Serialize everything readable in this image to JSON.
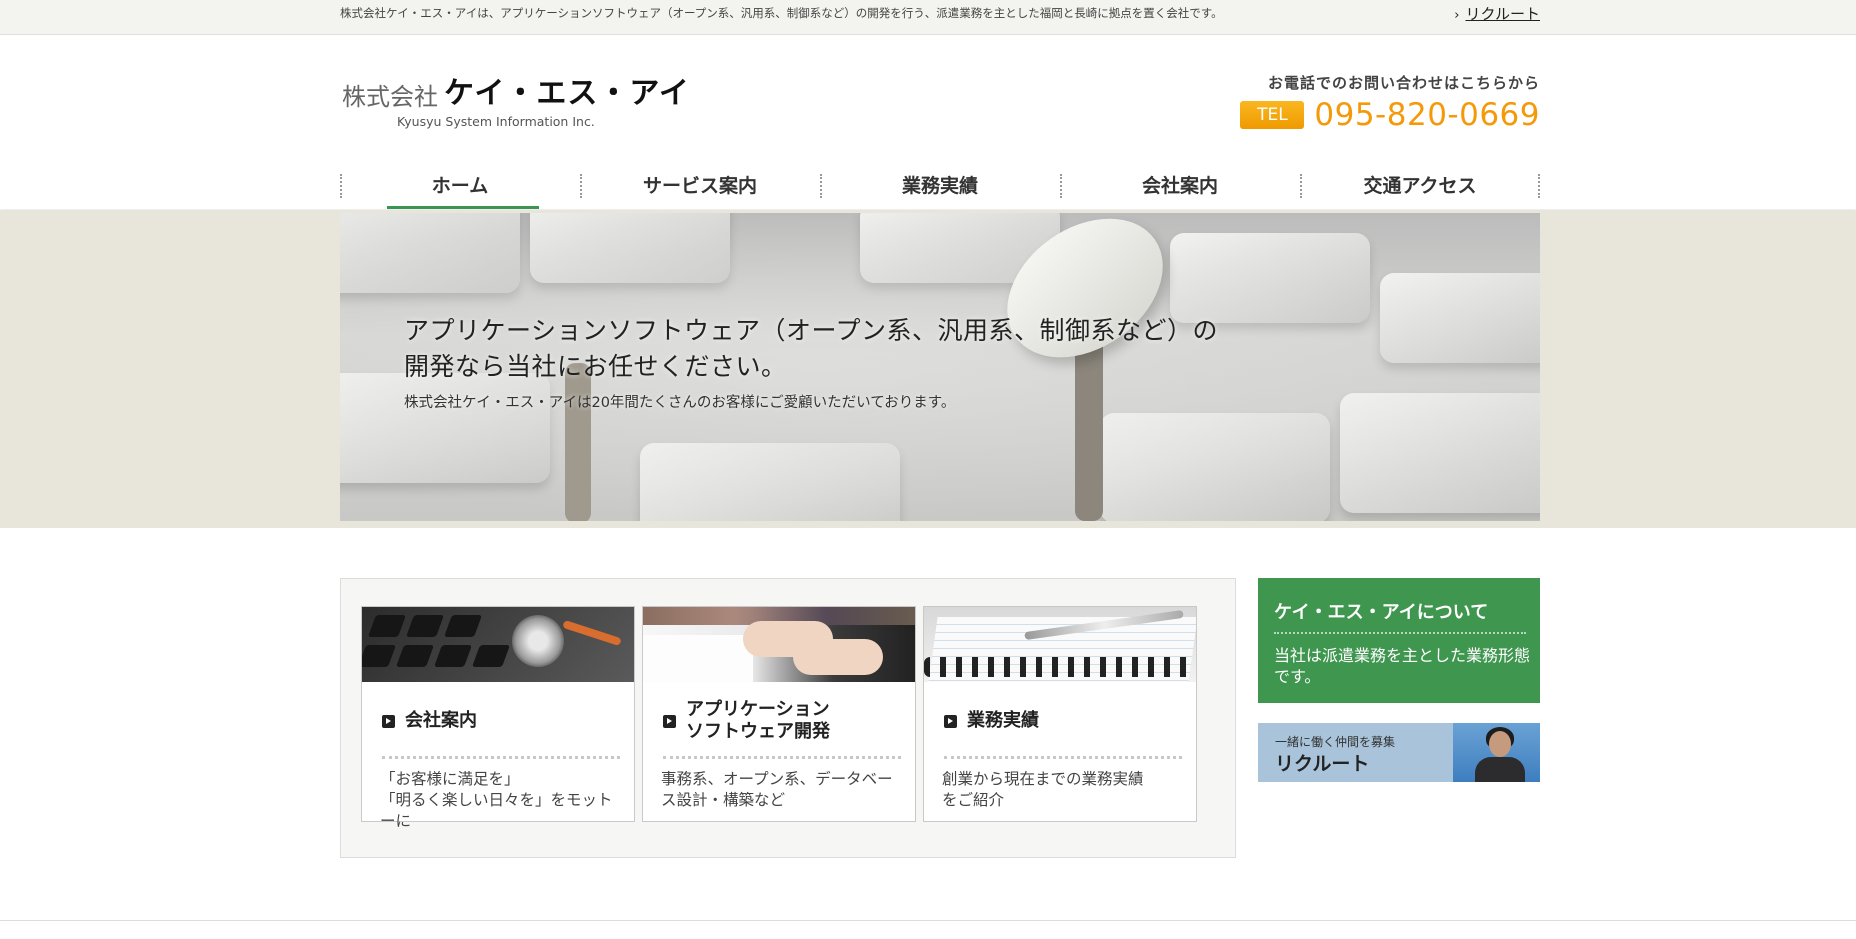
{
  "topbar": {
    "description": "株式会社ケイ・エス・アイは、アプリケーションソフトウェア（オープン系、汎用系、制御系など）の開発を行う、派遣業務を主とした福岡と長崎に拠点を置く会社です。",
    "recruit_link": "リクルート",
    "recruit_icon": "chevron-right-icon"
  },
  "header": {
    "logo_prefix": "株式会社",
    "logo_name": "ケイ・エス・アイ",
    "logo_en": "Kyusyu System Information Inc.",
    "contact_lead": "お電話でのお問い合わせはこちらから",
    "tel_badge": "TEL",
    "tel_number": "095-820-0669"
  },
  "nav": {
    "items": [
      {
        "label": "ホーム",
        "active": true
      },
      {
        "label": "サービス案内",
        "active": false
      },
      {
        "label": "業務実績",
        "active": false
      },
      {
        "label": "会社案内",
        "active": false
      },
      {
        "label": "交通アクセス",
        "active": false
      }
    ],
    "active_color": "#3b9651"
  },
  "hero": {
    "line1": "アプリケーションソフトウェア（オープン系、汎用系、制御系など）の",
    "line2": "開発なら当社にお任せください。",
    "sub": "株式会社ケイ・エス・アイは20年間たくさんのお客様にご愛顧いただいております。"
  },
  "cards": [
    {
      "title": "会社案内",
      "body1": "「お客様に満足を」",
      "body2": "「明るく楽しい日々を」をモットーに"
    },
    {
      "title1": "アプリケーション",
      "title2": "ソフトウェア開発",
      "body1": "事務系、オープン系、データベー",
      "body2": "ス設計・構築など"
    },
    {
      "title": "業務実績",
      "body1": "創業から現在までの業務実績",
      "body2": "をご紹介"
    }
  ],
  "sidebar": {
    "about_title": "ケイ・エス・アイについて",
    "about_desc": "当社は派遣業務を主とした業務形態です。",
    "about_color": "#3f964f",
    "recruit_sub": "一緒に働く仲間を募集",
    "recruit_title": "リクルート"
  }
}
